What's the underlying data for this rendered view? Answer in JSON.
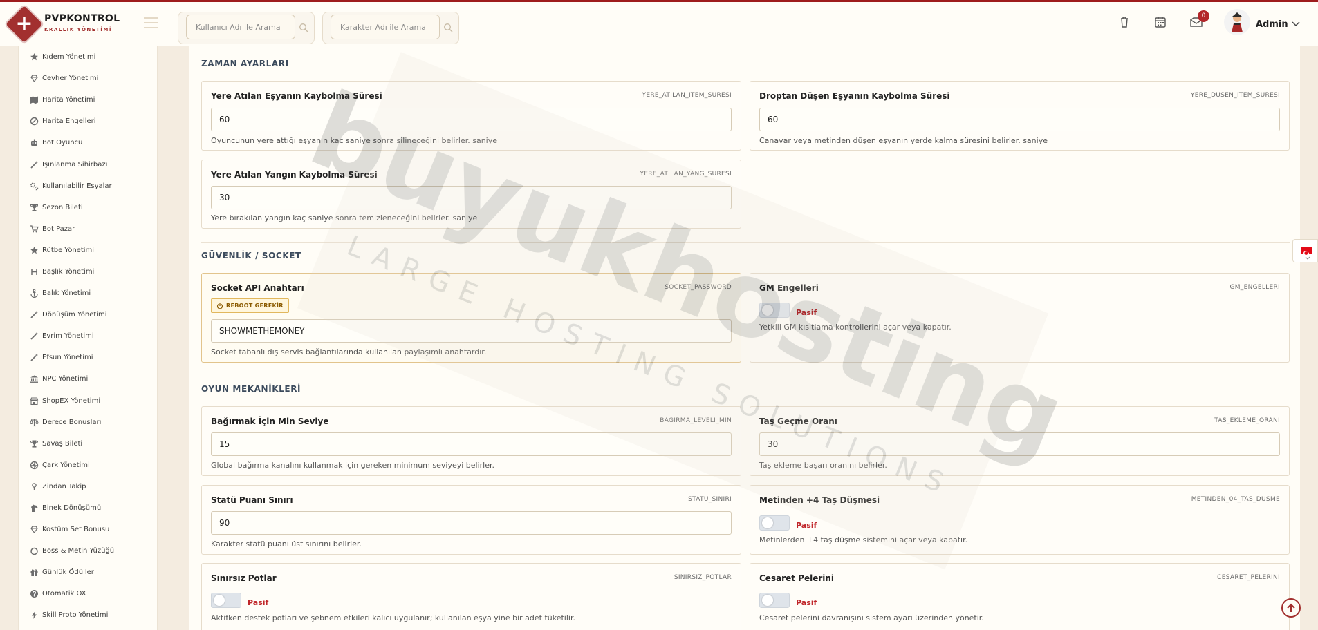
{
  "brand": {
    "title": "PVPKONTROL",
    "subtitle": "KRALLIK YÖNETİMİ"
  },
  "search": {
    "user_placeholder": "Kullanıcı Adı ile Arama",
    "char_placeholder": "Karakter Adı ile Arama"
  },
  "header": {
    "notification_count": "0",
    "admin_name": "Admin"
  },
  "sidebar": {
    "items": [
      {
        "label": "Kıdem Yönetimi",
        "icon": "star-icon"
      },
      {
        "label": "Cevher Yönetimi",
        "icon": "gem-icon"
      },
      {
        "label": "Harita Yönetimi",
        "icon": "map-icon"
      },
      {
        "label": "Harita Engelleri",
        "icon": "ban-icon"
      },
      {
        "label": "Bot Oyuncu",
        "icon": "robot-icon"
      },
      {
        "label": "Işınlanma Sihirbazı",
        "icon": "wand-icon"
      },
      {
        "label": "Kullanılabilir Eşyalar",
        "icon": "gears-icon"
      },
      {
        "label": "Sezon Bileti",
        "icon": "trophy-icon"
      },
      {
        "label": "Bot Pazar",
        "icon": "cart-icon"
      },
      {
        "label": "Rütbe Yönetimi",
        "icon": "star-icon"
      },
      {
        "label": "Başlık Yönetimi",
        "icon": "heading-icon"
      },
      {
        "label": "Balık Yönetimi",
        "icon": "anchor-icon"
      },
      {
        "label": "Dönüşüm Yönetimi",
        "icon": "wand-icon"
      },
      {
        "label": "Evrim Yönetimi",
        "icon": "wand-icon"
      },
      {
        "label": "Efsun Yönetimi",
        "icon": "wand-icon"
      },
      {
        "label": "NPC Yönetimi",
        "icon": "bank-icon"
      },
      {
        "label": "ShopEX Yönetimi",
        "icon": "store-icon"
      },
      {
        "label": "Derece Bonusları",
        "icon": "scale-icon"
      },
      {
        "label": "Savaş Bileti",
        "icon": "trophy-icon"
      },
      {
        "label": "Çark Yönetimi",
        "icon": "wheel-icon"
      },
      {
        "label": "Zindan Takip",
        "icon": "pin-icon"
      },
      {
        "label": "Binek Dönüşümü",
        "icon": "horse-icon"
      },
      {
        "label": "Kostüm Set Bonusu",
        "icon": "gem-icon"
      },
      {
        "label": "Boss & Metin Yüzüğü",
        "icon": "ring-icon"
      },
      {
        "label": "Günlük Ödüller",
        "icon": "gift-icon"
      },
      {
        "label": "Otomatik OX",
        "icon": "question-icon"
      },
      {
        "label": "Skill Proto Yönetimi",
        "icon": "bolt-icon"
      }
    ]
  },
  "sections": {
    "time": {
      "title": "ZAMAN AYARLARI",
      "cards": [
        {
          "label": "Yere Atılan Eşyanın Kaybolma Süresi",
          "key": "YERE_ATILAN_ITEM_SURESI",
          "value": "60",
          "desc": "Oyuncunun yere attığı eşyanın kaç saniye sonra silineceğini belirler. saniye"
        },
        {
          "label": "Droptan Düşen Eşyanın Kaybolma Süresi",
          "key": "YERE_DUSEN_ITEM_SURESI",
          "value": "60",
          "desc": "Canavar veya metinden düşen eşyanın yerde kalma süresini belirler. saniye"
        },
        {
          "label": "Yere Atılan Yangın Kaybolma Süresi",
          "key": "YERE_ATILAN_YANG_SURESI",
          "value": "30",
          "desc": "Yere bırakılan yangın kaç saniye sonra temizleneceğini belirler. saniye"
        }
      ]
    },
    "security": {
      "title": "GÜVENLİK / SOCKET",
      "socket": {
        "label": "Socket API Anahtarı",
        "key": "SOCKET_PASSWORD",
        "badge": "REBOOT GEREKİR",
        "value": "SHOWMETHEMONEY",
        "desc": "Socket tabanlı dış servis bağlantılarında kullanılan paylaşımlı anahtardır."
      },
      "gm": {
        "label": "GM Engelleri",
        "key": "GM_ENGELLERI",
        "state": "Pasif",
        "desc": "Yetkili GM kısıtlama kontrollerini açar veya kapatır."
      }
    },
    "mechanics": {
      "title": "OYUN MEKANİKLERİ",
      "shout": {
        "label": "Bağırmak İçin Min Seviye",
        "key": "BAGIRMA_LEVELI_MIN",
        "value": "15",
        "desc": "Global bağırma kanalını kullanmak için gereken minimum seviyeyi belirler."
      },
      "stone": {
        "label": "Taş Geçme Oranı",
        "key": "TAS_EKLEME_ORANI",
        "value": "30",
        "desc": "Taş ekleme başarı oranını belirler."
      },
      "status": {
        "label": "Statü Puanı Sınırı",
        "key": "STATU_SINIRI",
        "value": "90",
        "desc": "Karakter statü puanı üst sınırını belirler."
      },
      "metin": {
        "label": "Metinden +4 Taş Düşmesi",
        "key": "METINDEN_04_TAS_DUSME",
        "state": "Pasif",
        "desc": "Metinlerden +4 taş düşme sistemini açar veya kapatır."
      },
      "potions": {
        "label": "Sınırsız Potlar",
        "key": "SINIRSIZ_POTLAR",
        "state": "Pasif",
        "desc": "Aktifken destek potları ve şebnem etkileri kalıcı uygulanır; kullanılan eşya yine bir adet tüketilir."
      },
      "cape": {
        "label": "Cesaret Pelerini",
        "key": "CESARET_PELERINI",
        "state": "Pasif",
        "desc": "Cesaret pelerini davranışını sistem ayarı üzerinden yönetir."
      }
    }
  },
  "watermark": {
    "main": "buyukhosting",
    "sub": "LARGE HOSTING SOLUTIONS"
  },
  "colors": {
    "accent": "#a2302f",
    "danger_text": "#c0262a",
    "warning_border": "#e2c48c"
  }
}
